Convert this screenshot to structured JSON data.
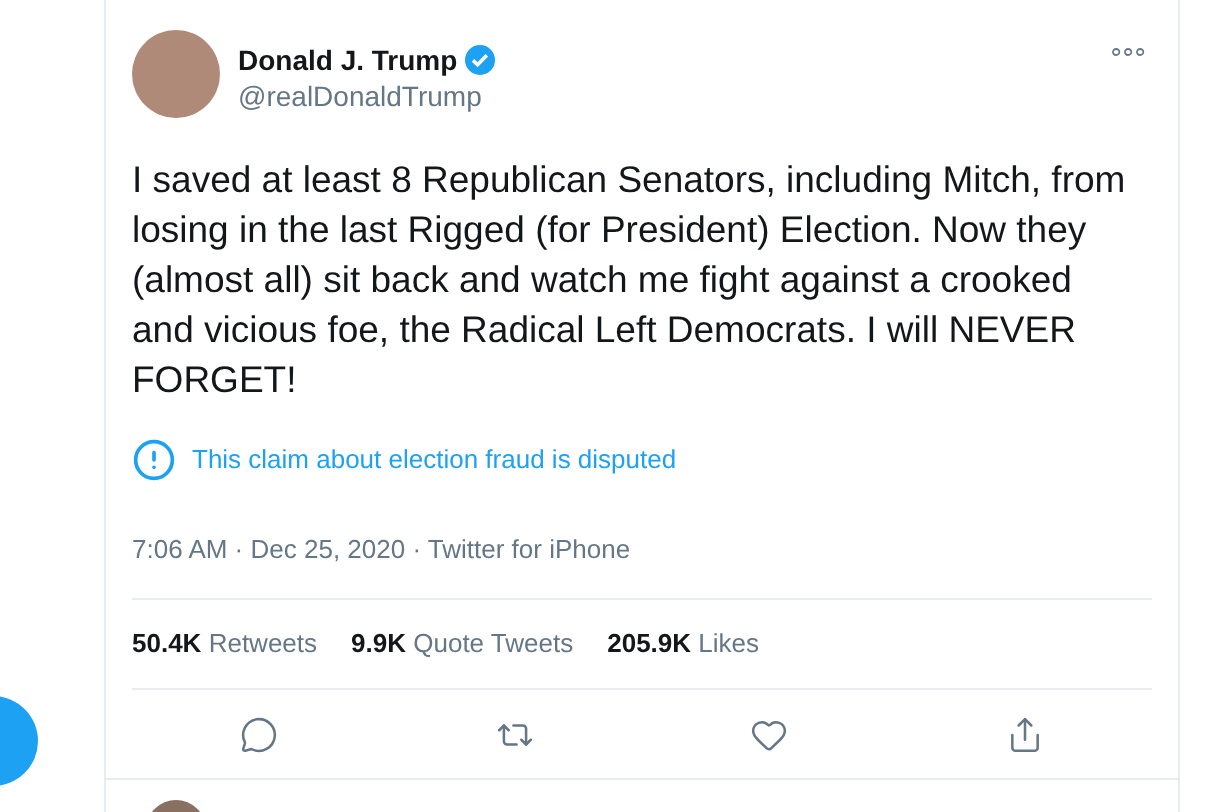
{
  "tweet": {
    "name": "Donald J. Trump",
    "verified": true,
    "handle": "@realDonaldTrump",
    "more": "∘∘∘",
    "text": "I saved at least 8 Republican Senators, including Mitch, from losing in the last Rigged (for President) Election. Now they (almost all) sit back and watch me fight against a crooked and vicious foe, the Radical Left Democrats. I will NEVER FORGET!",
    "notice": "This claim about election fraud is disputed",
    "meta": "7:06 AM · Dec 25, 2020 · Twitter for iPhone",
    "stats": [
      {
        "count": "50.4K",
        "label": "Retweets"
      },
      {
        "count": "9.9K",
        "label": "Quote Tweets"
      },
      {
        "count": "205.9K",
        "label": "Likes"
      }
    ],
    "actions": [
      {
        "kind": "reply"
      },
      {
        "kind": "retweet"
      },
      {
        "kind": "like"
      },
      {
        "kind": "share"
      }
    ]
  }
}
